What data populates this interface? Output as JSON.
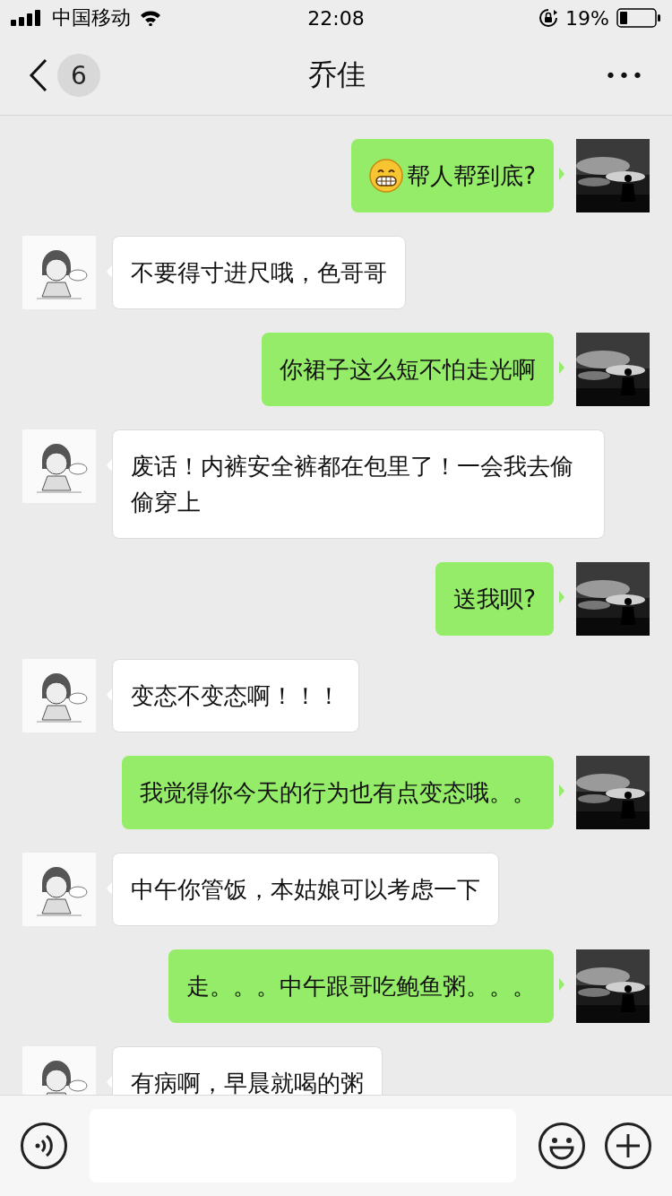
{
  "status_bar": {
    "carrier": "中国移动",
    "time": "22:08",
    "battery": "19%"
  },
  "header": {
    "back_count": "6",
    "title": "乔佳",
    "more": "•••"
  },
  "messages": [
    {
      "kind": "sent",
      "emoji": true,
      "text": "帮人帮到底?"
    },
    {
      "kind": "received",
      "emoji": false,
      "text": "不要得寸进尺哦，色哥哥"
    },
    {
      "kind": "sent",
      "emoji": false,
      "text": "你裙子这么短不怕走光啊"
    },
    {
      "kind": "received",
      "emoji": false,
      "text": "废话！内裤安全裤都在包里了！一会我去偷偷穿上"
    },
    {
      "kind": "sent",
      "emoji": false,
      "text": "送我呗?"
    },
    {
      "kind": "received",
      "emoji": false,
      "text": "变态不变态啊！！！"
    },
    {
      "kind": "sent",
      "emoji": false,
      "text": "我觉得你今天的行为也有点变态哦。。"
    },
    {
      "kind": "received",
      "emoji": false,
      "text": "中午你管饭，本姑娘可以考虑一下"
    },
    {
      "kind": "sent",
      "emoji": false,
      "text": "走。。。中午跟哥吃鲍鱼粥。。。"
    },
    {
      "kind": "received",
      "emoji": false,
      "text": "有病啊，早晨就喝的粥"
    }
  ]
}
